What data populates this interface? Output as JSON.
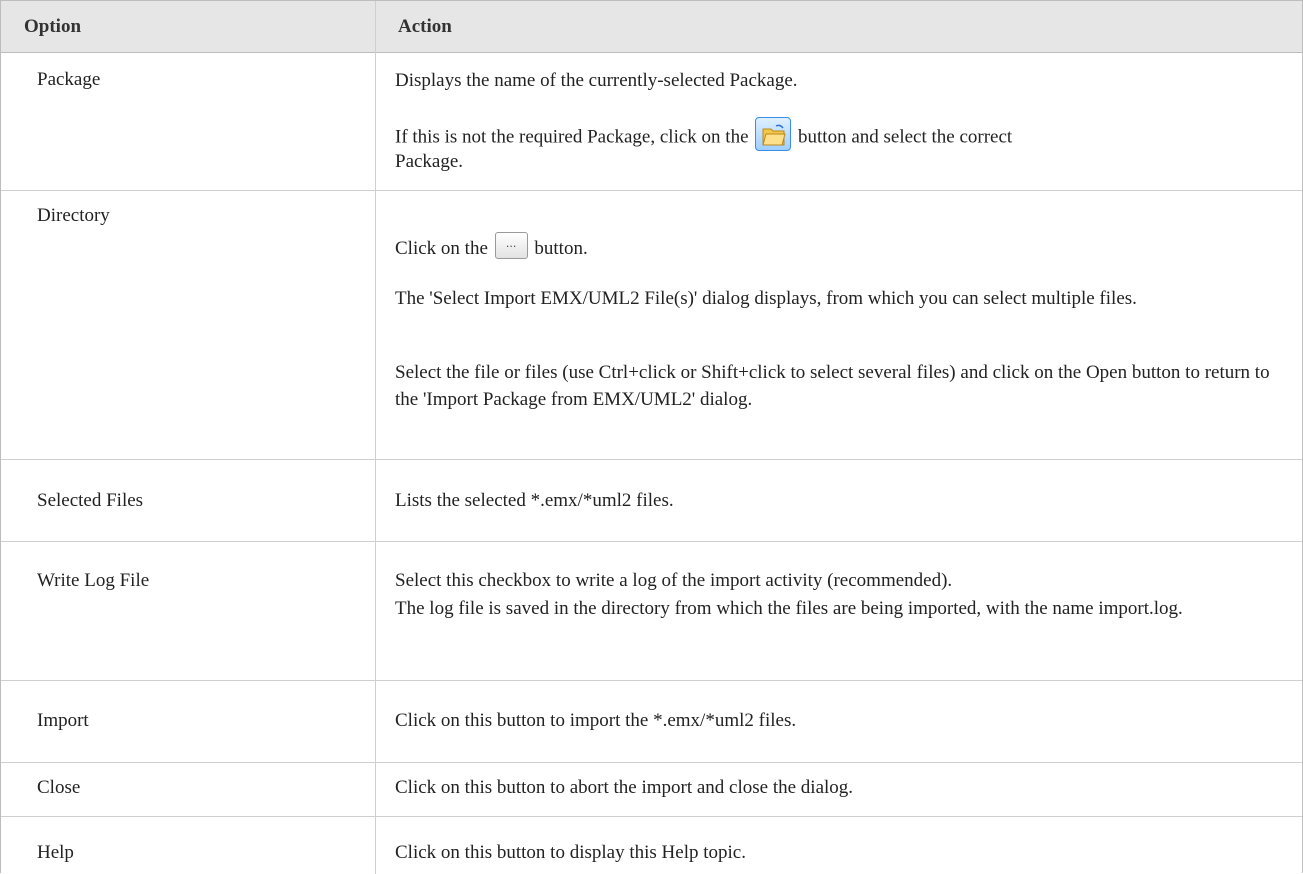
{
  "table": {
    "headers": [
      "Option",
      "Action"
    ],
    "rows": [
      {
        "option": "Package",
        "lines": [
          "Displays the name of the currently-selected Package.",
          "If this is not the required Package, click on the",
          "button and select the correct",
          "Package."
        ]
      },
      {
        "option": "Directory",
        "lines": [
          "Click on the",
          "button.",
          "The 'Select Import EMX/UML2 File(s)' dialog displays, from which you can select multiple files.",
          "Select the file or files (use Ctrl+click or Shift+click to select several files) and click on the Open button to return to the 'Import Package from EMX/UML2' dialog."
        ]
      },
      {
        "option": "Selected Files",
        "lines": [
          "Lists the selected *.emx/*uml2 files."
        ]
      },
      {
        "option": "Write Log File",
        "lines": [
          "Select this checkbox to write a log of the import activity (recommended).",
          "The log file is saved in the directory from which the files are being imported, with the name import.log."
        ]
      },
      {
        "option": "Import",
        "lines": [
          "Click on this button to import the *.emx/*uml2 files."
        ]
      },
      {
        "option": "Close",
        "lines": [
          "Click on this button to abort the import and close the dialog."
        ]
      },
      {
        "option": "Help",
        "lines": [
          "Click on this button to display this Help topic."
        ]
      }
    ]
  },
  "icons": {
    "package_button": "folder-open-icon",
    "directory_button": "ellipsis-icon",
    "dots": "..."
  }
}
